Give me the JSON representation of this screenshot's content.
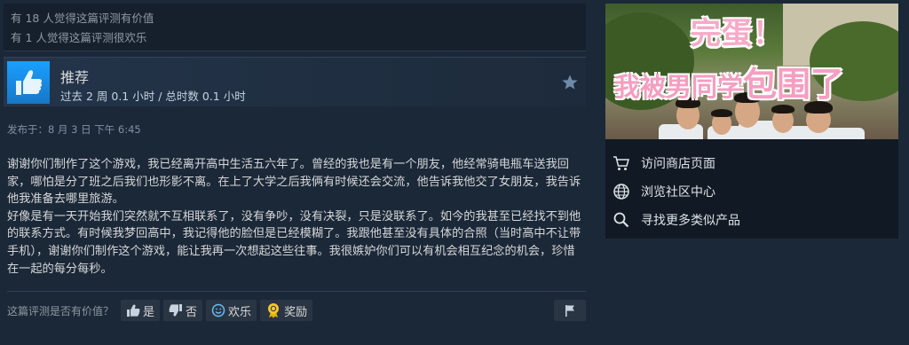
{
  "helpful": {
    "line1": "有 18 人觉得这篇评测有价值",
    "line2": "有 1 人觉得这篇评测很欢乐"
  },
  "recommendation": {
    "title": "推荐",
    "hours": "过去 2 周 0.1 小时 / 总时数 0.1 小时",
    "thumb_icon": "thumbs-up-icon",
    "accent": "#1a9fff"
  },
  "posted": "发布于：8 月 3 日 下午 6:45",
  "review": {
    "paragraphs": [
      "谢谢你们制作了这个游戏，我已经离开高中生活五六年了。曾经的我也是有一个朋友，他经常骑电瓶车送我回家，哪怕是分了班之后我们也形影不离。在上了大学之后我俩有时候还会交流，他告诉我他交了女朋友，我告诉他我准备去哪里旅游。",
      "好像是有一天开始我们突然就不互相联系了，没有争吵，没有决裂，只是没联系了。如今的我甚至已经找不到他的联系方式。有时候我梦回高中，我记得他的脸但是已经模糊了。我跟他甚至没有具体的合照（当时高中不让带手机），谢谢你们制作这个游戏，能让我再一次想起这些往事。我很嫉妒你们可以有机会相互纪念的机会，珍惜在一起的每分每秒。"
    ]
  },
  "vote": {
    "question": "这篇评测是否有价值？",
    "yes": "是",
    "no": "否",
    "funny": "欢乐",
    "award": "奖励"
  },
  "game": {
    "capsule_line1": "完蛋！",
    "capsule_line2_a": "我被男同学",
    "capsule_line2_b": "包围了"
  },
  "sidebar": {
    "links": [
      {
        "label": "访问商店页面",
        "icon": "cart-icon"
      },
      {
        "label": "浏览社区中心",
        "icon": "globe-icon"
      },
      {
        "label": "寻找更多类似产品",
        "icon": "search-icon"
      }
    ]
  }
}
